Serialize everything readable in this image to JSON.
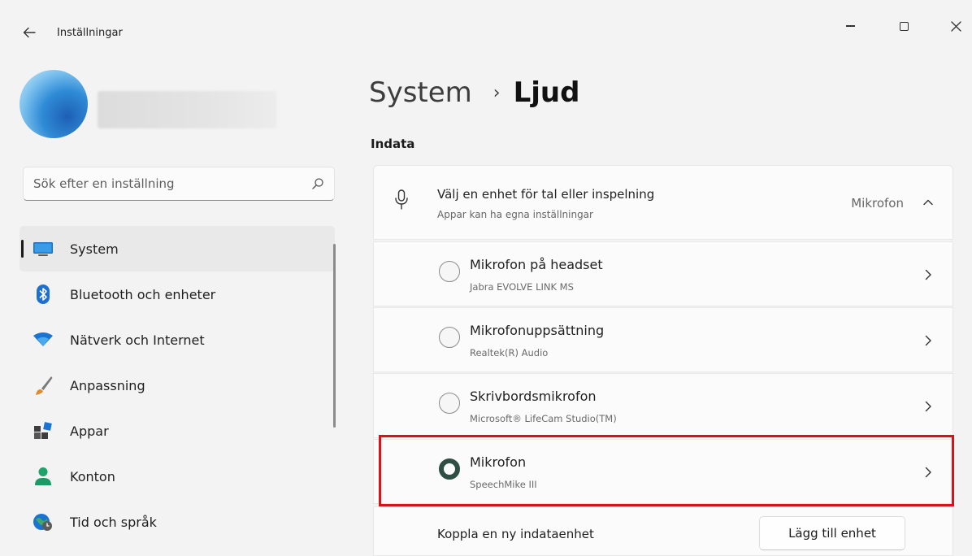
{
  "window": {
    "title": "Inställningar",
    "back_icon": "back-arrow-icon",
    "controls": [
      "minimize",
      "maximize",
      "close"
    ]
  },
  "user": {
    "name_blurred": true
  },
  "search": {
    "placeholder": "Sök efter en inställning",
    "value": ""
  },
  "sidebar": {
    "items": [
      {
        "label": "System",
        "icon": "system-icon",
        "active": true
      },
      {
        "label": "Bluetooth och enheter",
        "icon": "bluetooth-icon",
        "active": false
      },
      {
        "label": "Nätverk och Internet",
        "icon": "wifi-icon",
        "active": false
      },
      {
        "label": "Anpassning",
        "icon": "brush-icon",
        "active": false
      },
      {
        "label": "Appar",
        "icon": "apps-icon",
        "active": false
      },
      {
        "label": "Konton",
        "icon": "account-icon",
        "active": false
      },
      {
        "label": "Tid och språk",
        "icon": "globe-clock-icon",
        "active": false
      }
    ]
  },
  "breadcrumb": {
    "parent": "System",
    "separator": "›",
    "current": "Ljud"
  },
  "section": {
    "title": "Indata"
  },
  "input_header": {
    "title": "Välj en enhet för tal eller inspelning",
    "subtitle": "Appar kan ha egna inställningar",
    "selected_value": "Mikrofon",
    "expanded": true
  },
  "devices": [
    {
      "name": "Mikrofon på headset",
      "subtitle": "Jabra EVOLVE LINK MS",
      "selected": false
    },
    {
      "name": "Mikrofonuppsättning",
      "subtitle": "Realtek(R) Audio",
      "selected": false
    },
    {
      "name": "Skrivbordsmikrofon",
      "subtitle": "Microsoft® LifeCam Studio(TM)",
      "selected": false
    },
    {
      "name": "Mikrofon",
      "subtitle": "SpeechMike III",
      "selected": true
    }
  ],
  "add_device": {
    "label": "Koppla en ny indataenhet",
    "button": "Lägg till enhet"
  },
  "colors": {
    "background": "#f3f3f3",
    "card": "#fbfbfb",
    "highlight": "#d8121b",
    "selected_radio": "#2f4f44"
  }
}
